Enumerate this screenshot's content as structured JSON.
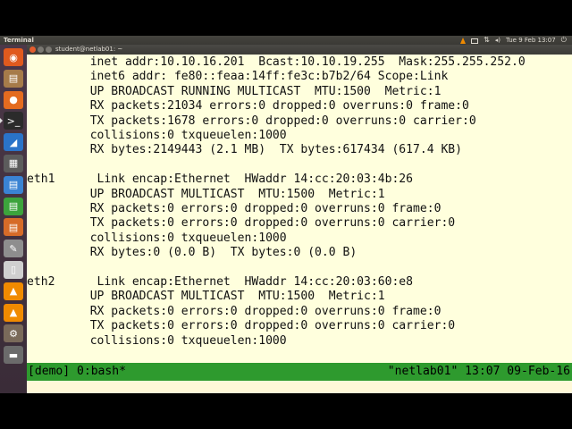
{
  "top_panel": {
    "app_title": "Terminal",
    "clock": "Tue 9 Feb 13:07"
  },
  "window": {
    "title": "student@netlab01: ~"
  },
  "launcher": {
    "items": [
      {
        "name": "ubuntu-dash-icon",
        "glyph": "◉",
        "color": "#e05a1e"
      },
      {
        "name": "files-icon",
        "glyph": "▤",
        "color": "#a67b4a"
      },
      {
        "name": "firefox-icon",
        "glyph": "●",
        "color": "#e46b1f"
      },
      {
        "name": "terminal-icon",
        "glyph": ">_",
        "color": "#2b2b2b",
        "active": true
      },
      {
        "name": "wireshark-icon",
        "glyph": "◢",
        "color": "#2a73c9"
      },
      {
        "name": "calculator-icon",
        "glyph": "▦",
        "color": "#5c5c5c"
      },
      {
        "name": "libreoffice-writer-icon",
        "glyph": "▤",
        "color": "#3a83d3"
      },
      {
        "name": "libreoffice-calc-icon",
        "glyph": "▤",
        "color": "#3ca33c"
      },
      {
        "name": "libreoffice-impress-icon",
        "glyph": "▤",
        "color": "#d66b28"
      },
      {
        "name": "text-editor-icon",
        "glyph": "✎",
        "color": "#8e8e8e"
      },
      {
        "name": "document-icon",
        "glyph": "▯",
        "color": "#cfcfcf"
      },
      {
        "name": "vlc-icon",
        "glyph": "▲",
        "color": "#f08a00"
      },
      {
        "name": "vlc-icon-2",
        "glyph": "▲",
        "color": "#f08a00"
      },
      {
        "name": "system-settings-icon",
        "glyph": "⚙",
        "color": "#7a6a5a"
      },
      {
        "name": "trash-icon",
        "glyph": "▬",
        "color": "#6b6b6b"
      }
    ]
  },
  "terminal": {
    "lines": [
      "         inet addr:10.10.16.201  Bcast:10.10.19.255  Mask:255.255.252.0",
      "         inet6 addr: fe80::feaa:14ff:fe3c:b7b2/64 Scope:Link",
      "         UP BROADCAST RUNNING MULTICAST  MTU:1500  Metric:1",
      "         RX packets:21034 errors:0 dropped:0 overruns:0 frame:0",
      "         TX packets:1678 errors:0 dropped:0 overruns:0 carrier:0",
      "         collisions:0 txqueuelen:1000",
      "         RX bytes:2149443 (2.1 MB)  TX bytes:617434 (617.4 KB)",
      "",
      "eth1      Link encap:Ethernet  HWaddr 14:cc:20:03:4b:26",
      "         UP BROADCAST MULTICAST  MTU:1500  Metric:1",
      "         RX packets:0 errors:0 dropped:0 overruns:0 frame:0",
      "         TX packets:0 errors:0 dropped:0 overruns:0 carrier:0",
      "         collisions:0 txqueuelen:1000",
      "         RX bytes:0 (0.0 B)  TX bytes:0 (0.0 B)",
      "",
      "eth2      Link encap:Ethernet  HWaddr 14:cc:20:03:60:e8",
      "         UP BROADCAST MULTICAST  MTU:1500  Metric:1",
      "         RX packets:0 errors:0 dropped:0 overruns:0 frame:0",
      "         TX packets:0 errors:0 dropped:0 overruns:0 carrier:0",
      "         collisions:0 txqueuelen:1000",
      "",
      ":"
    ]
  },
  "tmux": {
    "left": "[demo] 0:bash*",
    "right": "\"netlab01\" 13:07 09-Feb-16"
  },
  "colors": {
    "terminal_bg": "#ffffdd",
    "status_bar": "#2e9a2e",
    "launcher_bg": "#4c3848"
  }
}
